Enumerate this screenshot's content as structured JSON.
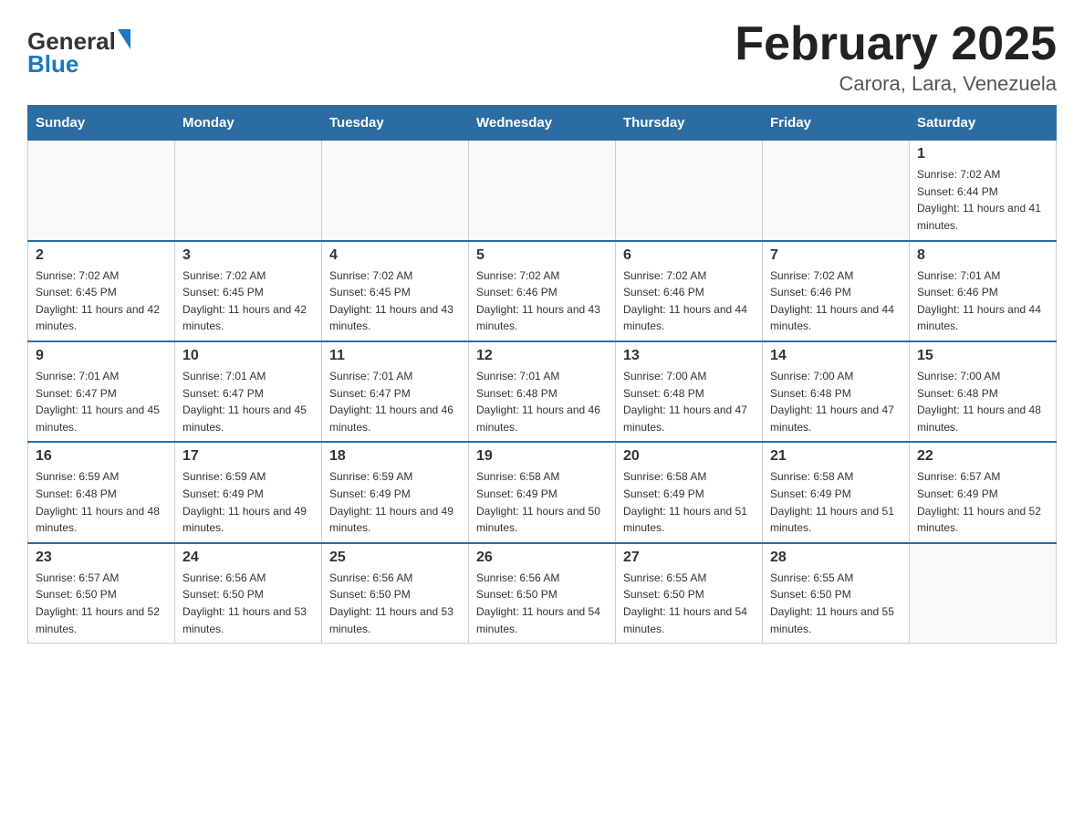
{
  "header": {
    "logo_text_general": "General",
    "logo_text_blue": "Blue",
    "month_title": "February 2025",
    "location": "Carora, Lara, Venezuela"
  },
  "weekdays": [
    "Sunday",
    "Monday",
    "Tuesday",
    "Wednesday",
    "Thursday",
    "Friday",
    "Saturday"
  ],
  "weeks": [
    [
      {
        "day": "",
        "sunrise": "",
        "sunset": "",
        "daylight": ""
      },
      {
        "day": "",
        "sunrise": "",
        "sunset": "",
        "daylight": ""
      },
      {
        "day": "",
        "sunrise": "",
        "sunset": "",
        "daylight": ""
      },
      {
        "day": "",
        "sunrise": "",
        "sunset": "",
        "daylight": ""
      },
      {
        "day": "",
        "sunrise": "",
        "sunset": "",
        "daylight": ""
      },
      {
        "day": "",
        "sunrise": "",
        "sunset": "",
        "daylight": ""
      },
      {
        "day": "1",
        "sunrise": "Sunrise: 7:02 AM",
        "sunset": "Sunset: 6:44 PM",
        "daylight": "Daylight: 11 hours and 41 minutes."
      }
    ],
    [
      {
        "day": "2",
        "sunrise": "Sunrise: 7:02 AM",
        "sunset": "Sunset: 6:45 PM",
        "daylight": "Daylight: 11 hours and 42 minutes."
      },
      {
        "day": "3",
        "sunrise": "Sunrise: 7:02 AM",
        "sunset": "Sunset: 6:45 PM",
        "daylight": "Daylight: 11 hours and 42 minutes."
      },
      {
        "day": "4",
        "sunrise": "Sunrise: 7:02 AM",
        "sunset": "Sunset: 6:45 PM",
        "daylight": "Daylight: 11 hours and 43 minutes."
      },
      {
        "day": "5",
        "sunrise": "Sunrise: 7:02 AM",
        "sunset": "Sunset: 6:46 PM",
        "daylight": "Daylight: 11 hours and 43 minutes."
      },
      {
        "day": "6",
        "sunrise": "Sunrise: 7:02 AM",
        "sunset": "Sunset: 6:46 PM",
        "daylight": "Daylight: 11 hours and 44 minutes."
      },
      {
        "day": "7",
        "sunrise": "Sunrise: 7:02 AM",
        "sunset": "Sunset: 6:46 PM",
        "daylight": "Daylight: 11 hours and 44 minutes."
      },
      {
        "day": "8",
        "sunrise": "Sunrise: 7:01 AM",
        "sunset": "Sunset: 6:46 PM",
        "daylight": "Daylight: 11 hours and 44 minutes."
      }
    ],
    [
      {
        "day": "9",
        "sunrise": "Sunrise: 7:01 AM",
        "sunset": "Sunset: 6:47 PM",
        "daylight": "Daylight: 11 hours and 45 minutes."
      },
      {
        "day": "10",
        "sunrise": "Sunrise: 7:01 AM",
        "sunset": "Sunset: 6:47 PM",
        "daylight": "Daylight: 11 hours and 45 minutes."
      },
      {
        "day": "11",
        "sunrise": "Sunrise: 7:01 AM",
        "sunset": "Sunset: 6:47 PM",
        "daylight": "Daylight: 11 hours and 46 minutes."
      },
      {
        "day": "12",
        "sunrise": "Sunrise: 7:01 AM",
        "sunset": "Sunset: 6:48 PM",
        "daylight": "Daylight: 11 hours and 46 minutes."
      },
      {
        "day": "13",
        "sunrise": "Sunrise: 7:00 AM",
        "sunset": "Sunset: 6:48 PM",
        "daylight": "Daylight: 11 hours and 47 minutes."
      },
      {
        "day": "14",
        "sunrise": "Sunrise: 7:00 AM",
        "sunset": "Sunset: 6:48 PM",
        "daylight": "Daylight: 11 hours and 47 minutes."
      },
      {
        "day": "15",
        "sunrise": "Sunrise: 7:00 AM",
        "sunset": "Sunset: 6:48 PM",
        "daylight": "Daylight: 11 hours and 48 minutes."
      }
    ],
    [
      {
        "day": "16",
        "sunrise": "Sunrise: 6:59 AM",
        "sunset": "Sunset: 6:48 PM",
        "daylight": "Daylight: 11 hours and 48 minutes."
      },
      {
        "day": "17",
        "sunrise": "Sunrise: 6:59 AM",
        "sunset": "Sunset: 6:49 PM",
        "daylight": "Daylight: 11 hours and 49 minutes."
      },
      {
        "day": "18",
        "sunrise": "Sunrise: 6:59 AM",
        "sunset": "Sunset: 6:49 PM",
        "daylight": "Daylight: 11 hours and 49 minutes."
      },
      {
        "day": "19",
        "sunrise": "Sunrise: 6:58 AM",
        "sunset": "Sunset: 6:49 PM",
        "daylight": "Daylight: 11 hours and 50 minutes."
      },
      {
        "day": "20",
        "sunrise": "Sunrise: 6:58 AM",
        "sunset": "Sunset: 6:49 PM",
        "daylight": "Daylight: 11 hours and 51 minutes."
      },
      {
        "day": "21",
        "sunrise": "Sunrise: 6:58 AM",
        "sunset": "Sunset: 6:49 PM",
        "daylight": "Daylight: 11 hours and 51 minutes."
      },
      {
        "day": "22",
        "sunrise": "Sunrise: 6:57 AM",
        "sunset": "Sunset: 6:49 PM",
        "daylight": "Daylight: 11 hours and 52 minutes."
      }
    ],
    [
      {
        "day": "23",
        "sunrise": "Sunrise: 6:57 AM",
        "sunset": "Sunset: 6:50 PM",
        "daylight": "Daylight: 11 hours and 52 minutes."
      },
      {
        "day": "24",
        "sunrise": "Sunrise: 6:56 AM",
        "sunset": "Sunset: 6:50 PM",
        "daylight": "Daylight: 11 hours and 53 minutes."
      },
      {
        "day": "25",
        "sunrise": "Sunrise: 6:56 AM",
        "sunset": "Sunset: 6:50 PM",
        "daylight": "Daylight: 11 hours and 53 minutes."
      },
      {
        "day": "26",
        "sunrise": "Sunrise: 6:56 AM",
        "sunset": "Sunset: 6:50 PM",
        "daylight": "Daylight: 11 hours and 54 minutes."
      },
      {
        "day": "27",
        "sunrise": "Sunrise: 6:55 AM",
        "sunset": "Sunset: 6:50 PM",
        "daylight": "Daylight: 11 hours and 54 minutes."
      },
      {
        "day": "28",
        "sunrise": "Sunrise: 6:55 AM",
        "sunset": "Sunset: 6:50 PM",
        "daylight": "Daylight: 11 hours and 55 minutes."
      },
      {
        "day": "",
        "sunrise": "",
        "sunset": "",
        "daylight": ""
      }
    ]
  ]
}
